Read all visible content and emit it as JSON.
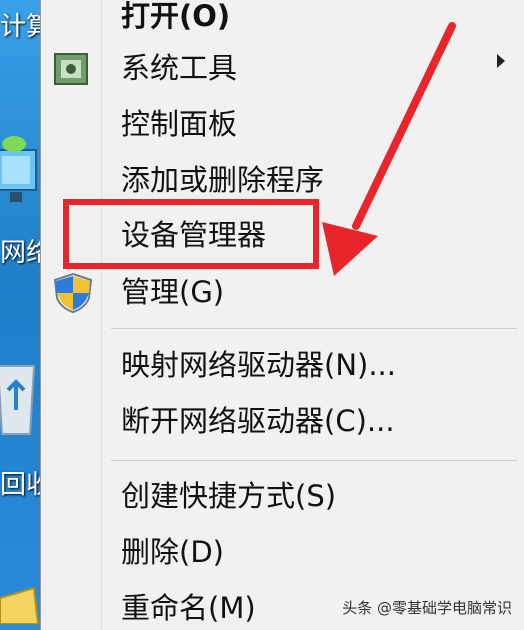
{
  "desktop": {
    "labels": [
      "计算",
      "网络",
      "回收"
    ]
  },
  "menu": {
    "items": [
      {
        "label": "打开(O)",
        "bold": true
      },
      {
        "label": "系统工具",
        "icon": "system-tools-icon",
        "submenu": true
      },
      {
        "label": "控制面板"
      },
      {
        "label": "添加或删除程序"
      },
      {
        "label": "设备管理器",
        "highlighted": true
      },
      {
        "label": "管理(G)",
        "icon": "shield-icon"
      },
      {
        "label": "映射网络驱动器(N)..."
      },
      {
        "label": "断开网络驱动器(C)..."
      },
      {
        "label": "创建快捷方式(S)"
      },
      {
        "label": "删除(D)"
      },
      {
        "label": "重命名(M)"
      }
    ]
  },
  "watermark": "头条 @零基础学电脑常识",
  "colors": {
    "annotation": "#e8252b",
    "menu_bg": "#f1f1f1",
    "desktop_bg": "#2f8fd6"
  }
}
